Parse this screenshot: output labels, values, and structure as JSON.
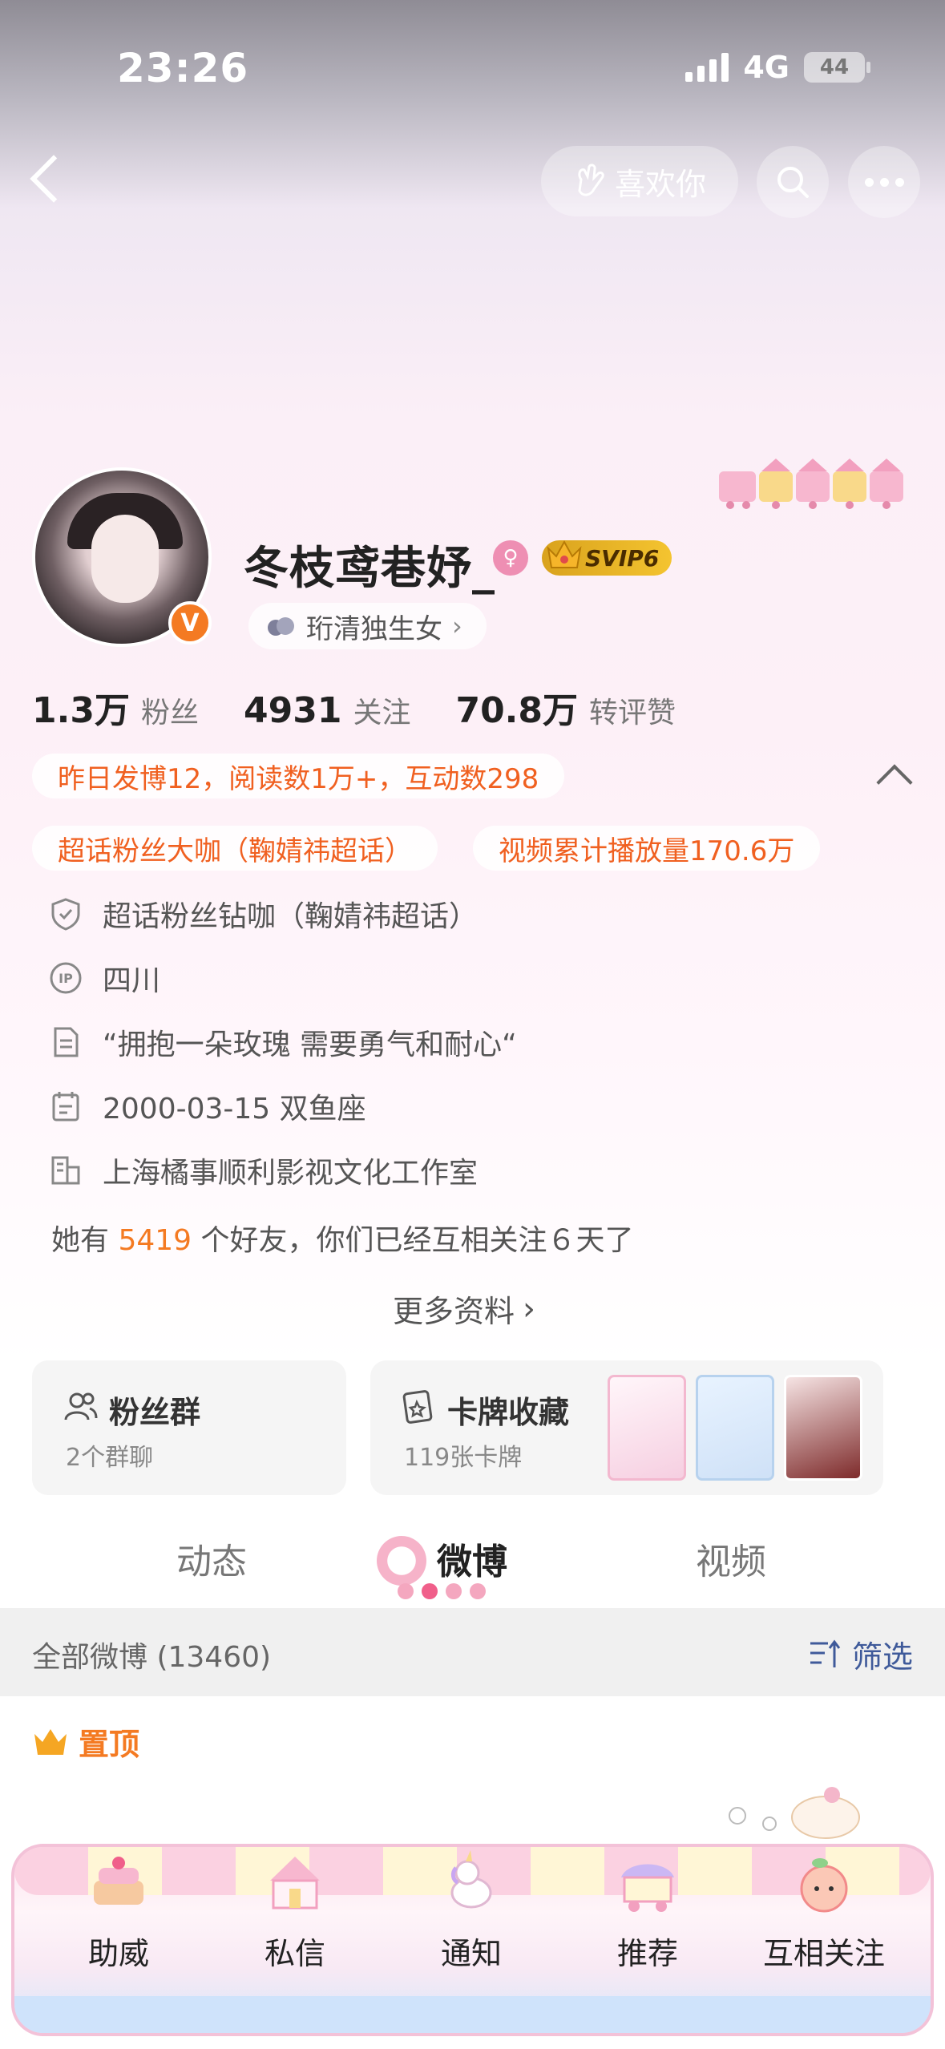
{
  "status_bar": {
    "time": "23:26",
    "network": "4G",
    "battery": "44"
  },
  "nav": {
    "like_label": "喜欢你"
  },
  "profile": {
    "name": "冬枝鸢巷妤_",
    "vip_badge": "SVIP6",
    "group_tag": "珩清独生女",
    "stats": [
      {
        "value": "1.3万",
        "label": "粉丝"
      },
      {
        "value": "4931",
        "label": "关注"
      },
      {
        "value": "70.8万",
        "label": "转评赞"
      }
    ],
    "yesterday_summary": "昨日发博12，阅读数1万+，互动数298",
    "badges": [
      "超话粉丝大咖（鞠婧祎超话）",
      "视频累计播放量170.6万"
    ],
    "info_rows": [
      {
        "icon": "shield-icon",
        "text": "超话粉丝钻咖（鞠婧祎超话）"
      },
      {
        "icon": "ip-icon",
        "text": "四川"
      },
      {
        "icon": "document-icon",
        "text": "“拥抱一朵玫瑰 需要勇气和耐心“"
      },
      {
        "icon": "calendar-icon",
        "text": "2000-03-15 双鱼座"
      },
      {
        "icon": "building-icon",
        "text": "上海橘事顺利影视文化工作室"
      }
    ],
    "friends_prefix": "她有",
    "friends_count": "5419",
    "friends_suffix": "个好友，你们已经互相关注６天了",
    "more_info": "更多资料"
  },
  "cards": {
    "fan_group": {
      "title": "粉丝群",
      "subtitle": "2个群聊"
    },
    "card_collection": {
      "title": "卡牌收藏",
      "subtitle": "119张卡牌"
    }
  },
  "tabs": [
    {
      "label": "动态",
      "active": false
    },
    {
      "label": "微博",
      "active": true
    },
    {
      "label": "视频",
      "active": false
    }
  ],
  "filter_bar": {
    "all_posts": "全部微博 (13460)",
    "filter": "筛选"
  },
  "pinned_label": "置顶",
  "bottom_nav": [
    {
      "label": "助威",
      "icon": "cake-icon"
    },
    {
      "label": "私信",
      "icon": "carousel-icon"
    },
    {
      "label": "通知",
      "icon": "unicorn-icon"
    },
    {
      "label": "推荐",
      "icon": "cart-icon"
    },
    {
      "label": "互相关注",
      "icon": "peach-icon"
    }
  ],
  "colors": {
    "accent_orange": "#f47a22",
    "filter_blue": "#3f5a9a",
    "pink": "#f4a7bf"
  }
}
